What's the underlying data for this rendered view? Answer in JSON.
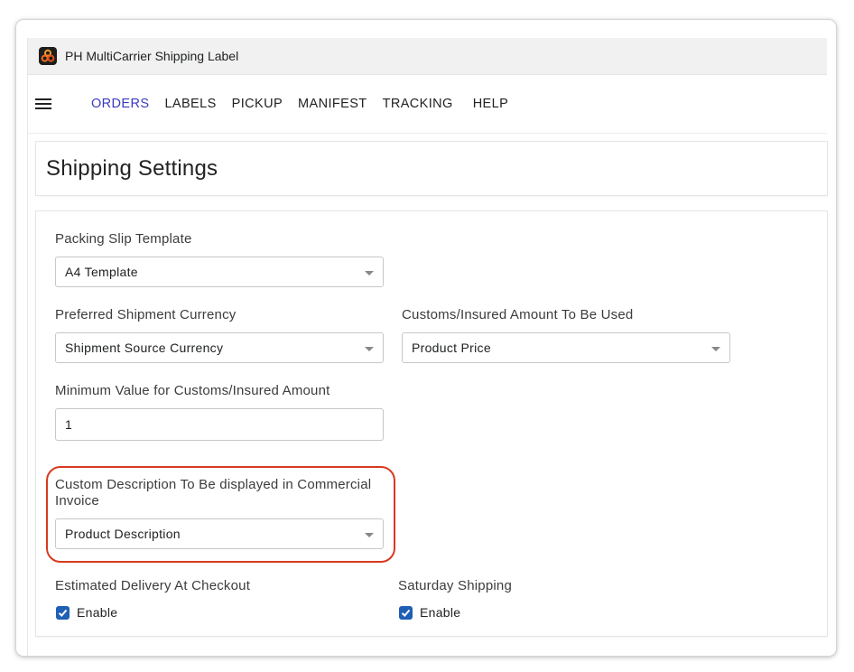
{
  "app": {
    "title": "PH MultiCarrier Shipping Label"
  },
  "nav": {
    "items": [
      {
        "label": "ORDERS"
      },
      {
        "label": "LABELS"
      },
      {
        "label": "PICKUP"
      },
      {
        "label": "MANIFEST"
      },
      {
        "label": "TRACKING"
      },
      {
        "label": "HELP"
      }
    ],
    "active_index": 0
  },
  "page": {
    "title": "Shipping Settings"
  },
  "form": {
    "packing_slip_template": {
      "label": "Packing Slip Template",
      "value": "A4 Template"
    },
    "preferred_currency": {
      "label": "Preferred Shipment Currency",
      "value": "Shipment Source Currency"
    },
    "customs_amount": {
      "label": "Customs/Insured Amount To Be Used",
      "value": "Product Price"
    },
    "min_customs_value": {
      "label": "Minimum Value for Customs/Insured Amount",
      "value": "1"
    },
    "custom_description": {
      "label": "Custom Description To Be displayed in Commercial Invoice",
      "value": "Product Description"
    },
    "estimated_delivery": {
      "label": "Estimated Delivery At Checkout",
      "checkbox_label": "Enable",
      "checked": true
    },
    "saturday_shipping": {
      "label": "Saturday Shipping",
      "checkbox_label": "Enable",
      "checked": true
    }
  },
  "colors": {
    "accent": "#3b3bbf",
    "highlight": "#d83a1e",
    "checkbox": "#1f5fb4"
  }
}
